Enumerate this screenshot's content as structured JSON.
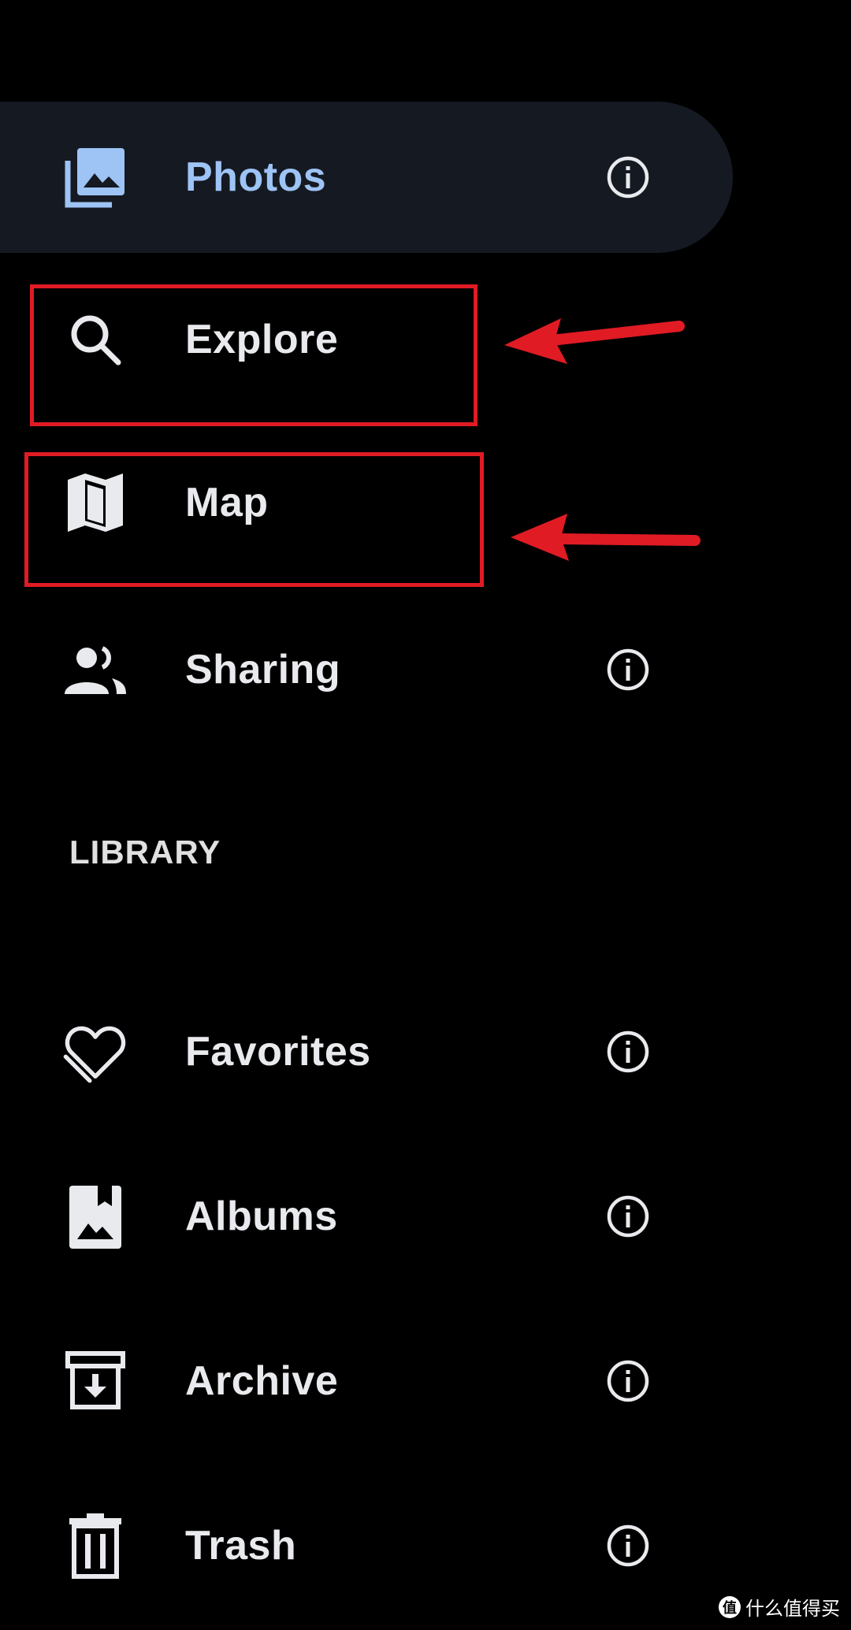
{
  "nav": {
    "photos": {
      "label": "Photos",
      "icon": "photos-icon",
      "active": true
    },
    "explore": {
      "label": "Explore",
      "icon": "search-icon"
    },
    "map": {
      "label": "Map",
      "icon": "map-icon"
    },
    "sharing": {
      "label": "Sharing",
      "icon": "people-icon"
    }
  },
  "library": {
    "header": "LIBRARY",
    "favorites": {
      "label": "Favorites",
      "icon": "heart-icon"
    },
    "albums": {
      "label": "Albums",
      "icon": "album-icon"
    },
    "archive": {
      "label": "Archive",
      "icon": "archive-icon"
    },
    "trash": {
      "label": "Trash",
      "icon": "trash-icon"
    }
  },
  "watermark": {
    "text": "什么值得买",
    "logo": "值"
  },
  "colors": {
    "background": "#000000",
    "active_bg": "#151a22",
    "active_text": "#9ec3f5",
    "text": "#e8eaed",
    "annotation": "#e01b24"
  }
}
